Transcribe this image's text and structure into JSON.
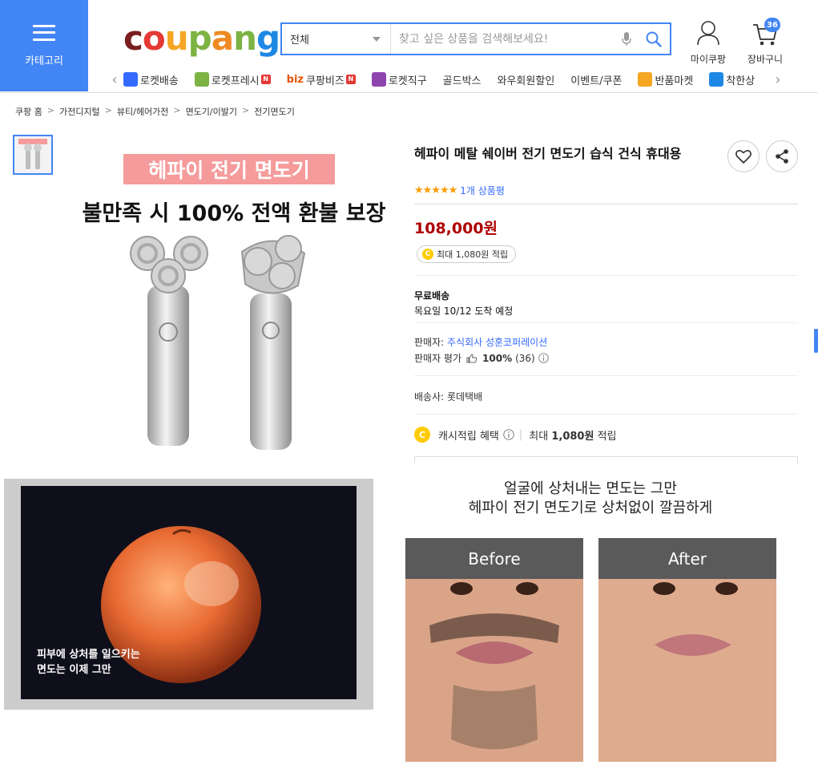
{
  "header": {
    "category_label": "카테고리",
    "logo": [
      "c",
      "o",
      "u",
      "p",
      "a",
      "n",
      "g"
    ],
    "logo_colors": [
      "#7a1f1f",
      "#e53935",
      "#f5a623",
      "#7cb342",
      "#ee8a24",
      "#7cb342",
      "#1e88e5"
    ],
    "search": {
      "scope": "전체",
      "placeholder": "찾고 싶은 상품을 검색해보세요!"
    },
    "mycoupang_label": "마이쿠팡",
    "cart_label": "장바구니",
    "cart_count": "36"
  },
  "nav": {
    "items": [
      {
        "label": "로켓배송",
        "icon": "rocket-icon",
        "color": "#346aff"
      },
      {
        "label": "로켓프레시",
        "icon": "rocket-fresh-icon",
        "color": "#7cb342",
        "n_badge": "N"
      },
      {
        "label": "쿠팡비즈",
        "prefix": "biz",
        "n_badge": "N"
      },
      {
        "label": "로켓직구",
        "icon": "global-rocket-icon",
        "color": "#8e44ad"
      },
      {
        "label": "골드박스"
      },
      {
        "label": "와우회원할인"
      },
      {
        "label": "이벤트/쿠폰"
      },
      {
        "label": "반품마켓",
        "icon": "return-market-icon",
        "color": "#f5a623"
      },
      {
        "label": "착한상",
        "icon": "good-shop-icon",
        "color": "#1e88e5"
      }
    ]
  },
  "breadcrumb": [
    "쿠팡 홈",
    "가전디지털",
    "뷰티/헤어가전",
    "면도기/이발기",
    "전기면도기"
  ],
  "breadcrumb_sep": ">",
  "hero": {
    "banner": "헤파이 전기 면도기",
    "headline": "불만족 시 100% 전액 환불 보장"
  },
  "product": {
    "title": "헤파이 메탈 쉐이버 전기 면도기 습식 건식 휴대용",
    "stars": "★★★★★",
    "rating_value": 5,
    "review_count": "1개 상품평",
    "price": "108,000원",
    "points": "최대 1,080원 적립",
    "shipping_title": "무료배송",
    "shipping_date": "목요일 10/12 도착 예정",
    "seller_label": "판매자:",
    "seller_name": "주식회사 성훈코퍼레이션",
    "seller_rating_label": "판매자 평가",
    "seller_rating_pct": "100%",
    "seller_rating_count": "(36)",
    "courier": "배송사: 롯데택배",
    "cash_label": "캐시적립 혜택",
    "cash_sep": "|",
    "cash_max": "최대",
    "cash_amount": "1,080원",
    "cash_suffix": "적립"
  },
  "detail": {
    "orange_caption_1": "피부에 상처를 일으키는",
    "orange_caption_2": "면도는 이제 그만",
    "compare_caption_1": "얼굴에 상처내는 면도는 그만",
    "compare_caption_2": "헤파이 전기 면도기로 상처없이 깔끔하게",
    "before_label": "Before",
    "after_label": "After"
  }
}
